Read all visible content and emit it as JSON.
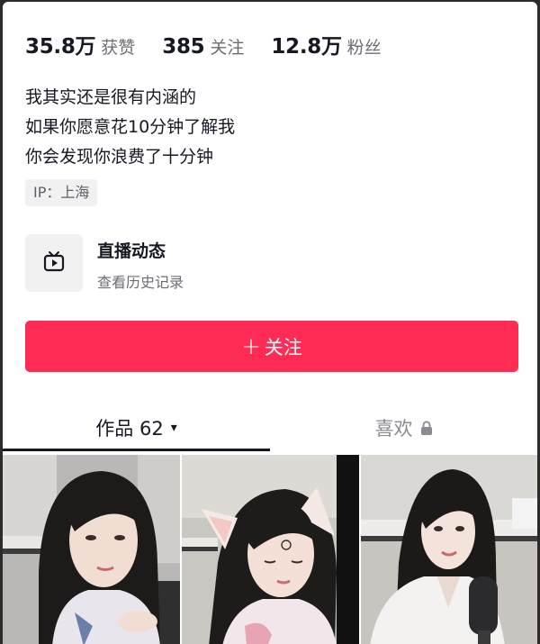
{
  "stats": [
    {
      "value": "35.8万",
      "label": "获赞"
    },
    {
      "value": "385",
      "label": "关注"
    },
    {
      "value": "12.8万",
      "label": "粉丝"
    }
  ],
  "bio": {
    "lines": [
      "我其实还是很有内涵的",
      "如果你愿意花10分钟了解我",
      "你会发现你浪费了十分钟"
    ]
  },
  "ip": "IP：上海",
  "live": {
    "title": "直播动态",
    "subtitle": "查看历史记录",
    "icon": "tv-play-icon"
  },
  "follow": {
    "label": "关注",
    "plus": "+",
    "color": "#fe2c55"
  },
  "tabs": {
    "works_label": "作品 62",
    "likes_label": "喜欢",
    "caret": "▾"
  },
  "videos": [
    {
      "name": "video-thumbnail-1"
    },
    {
      "name": "video-thumbnail-2"
    },
    {
      "name": "video-thumbnail-3"
    }
  ]
}
